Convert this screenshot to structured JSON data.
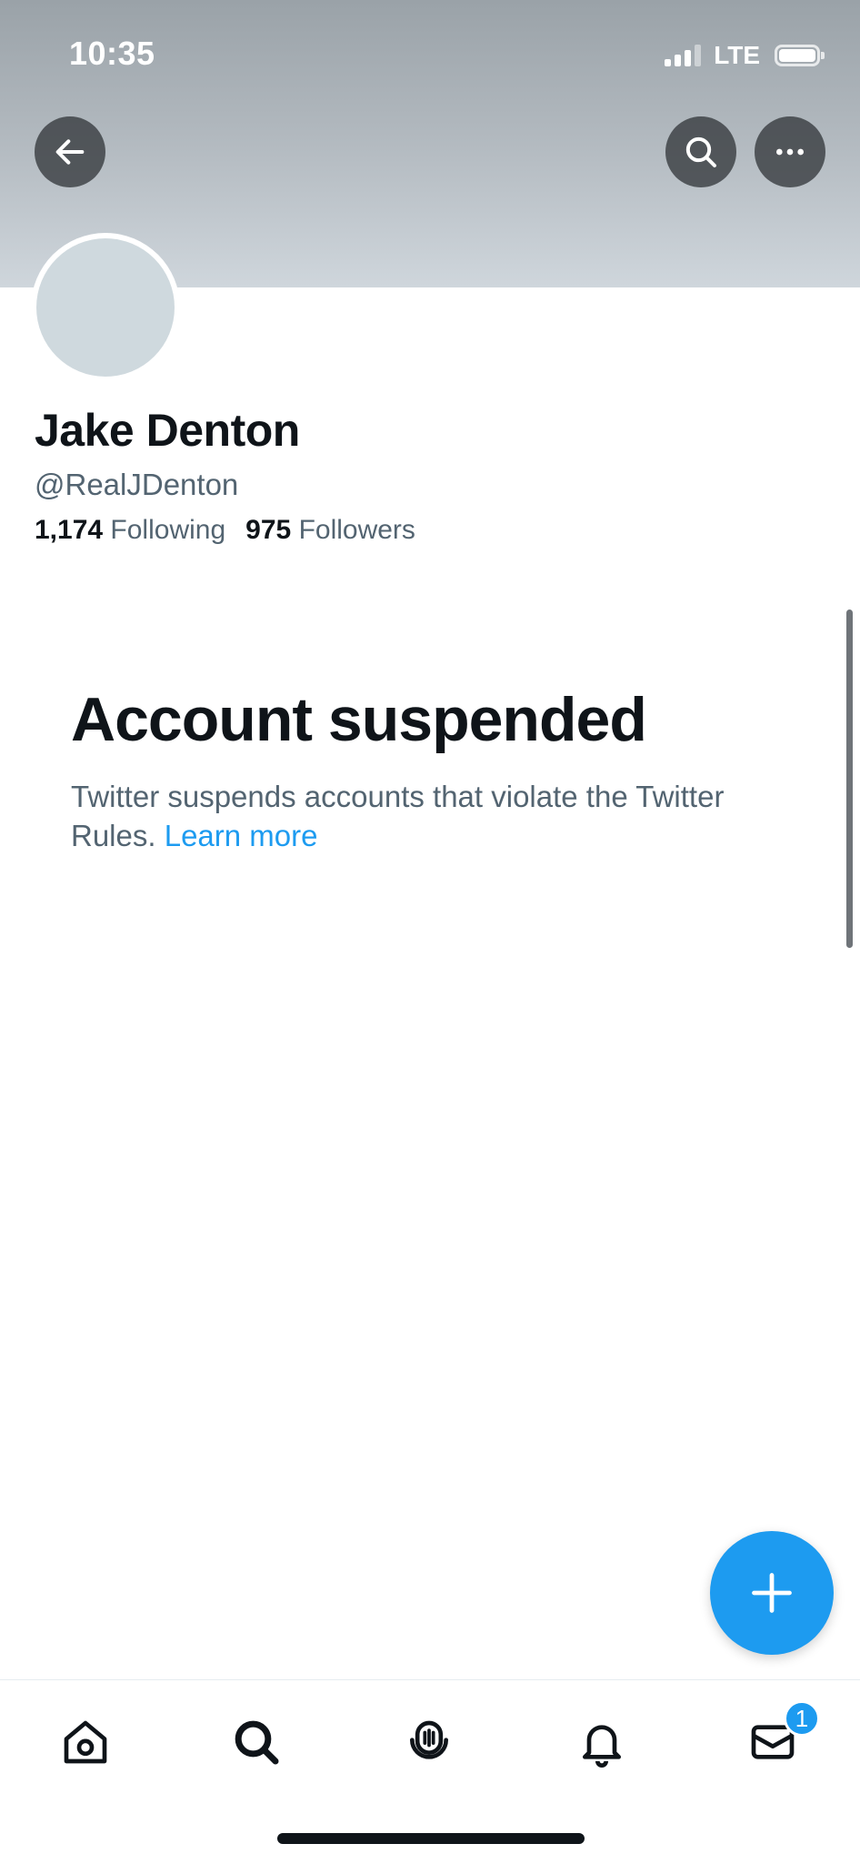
{
  "status_bar": {
    "time": "10:35",
    "network": "LTE"
  },
  "profile": {
    "name": "Jake Denton",
    "handle": "@RealJDenton",
    "following_count": "1,174",
    "following_label": "Following",
    "followers_count": "975",
    "followers_label": "Followers"
  },
  "suspended": {
    "title": "Account suspended",
    "message": "Twitter suspends accounts that violate the Twitter Rules.",
    "link": "Learn more"
  },
  "tab_bar": {
    "items": [
      "home-icon",
      "search-icon",
      "spaces-icon",
      "bell-icon",
      "mail-icon"
    ],
    "messages_badge": "1"
  },
  "colors": {
    "accent": "#1d9bf0",
    "text": "#0f1419",
    "secondary_text": "#536471"
  }
}
